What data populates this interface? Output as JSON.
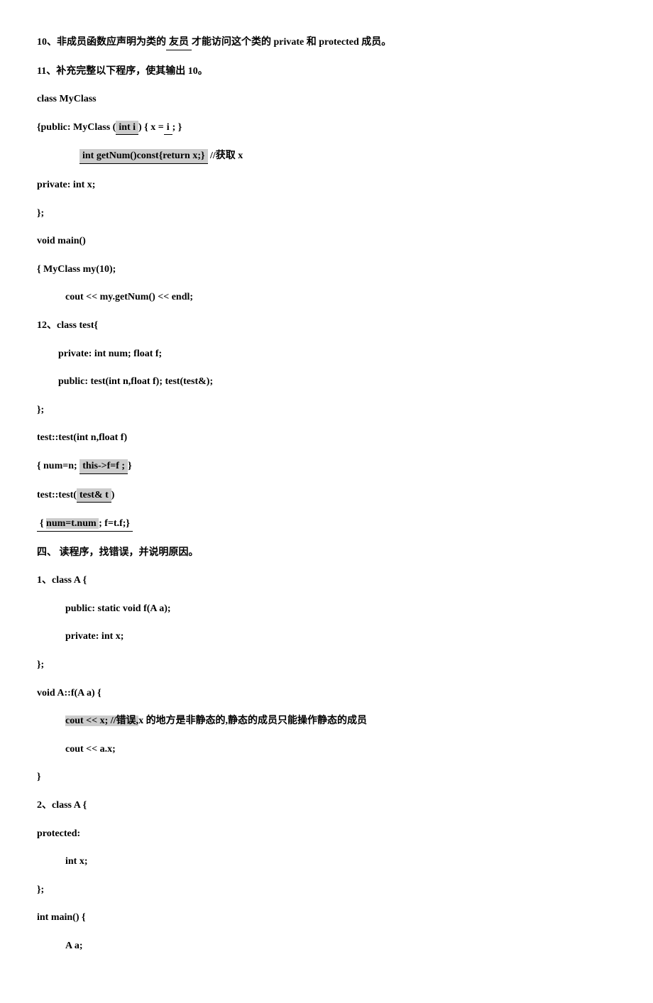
{
  "q10": {
    "prefix": "10、非成员函数应声明为类的",
    "blank1": "   友员         ",
    "suffix": "才能访问这个类的 private 和 protected 成员。"
  },
  "q11": {
    "title": "11、补充完整以下程序，使其输出    10。",
    "l1": "class MyClass",
    "l2a": "{public:      MyClass (",
    "l2b": "   int i   ",
    "l2c": ") { x =",
    "l2d": " i ",
    "l2e": "; }",
    "l3a": "  int getNum()const{return x;}    ",
    "l3b": " //获取 x",
    "l4": "private:      int x;",
    "l5": "};",
    "l6": "void main()",
    "l7": "{          MyClass my(10);",
    "l8": "cout << my.getNum() << endl;"
  },
  "q12": {
    "l1": "12、class test{",
    "l2": "private:     int num;           float f;",
    "l3": "public:    test(int n,float f);      test(test&);",
    "l4": "};",
    "l5": "test::test(int n,float f)",
    "l6a": "{     num=n;    ",
    "l6b": "    this->f=f ;",
    "l6c": "}",
    "l7a": "test::test(",
    "l7b": " test& t ",
    "l7c": ")",
    "l8a": "{    ",
    "l8b": "num=t.num     ",
    "l8c": ";         f=t.f;}"
  },
  "sec4": {
    "title": "四、 读程序，找错误，并说明原因。",
    "q1": {
      "l1": "1、class A {",
      "l2": "public:             static void f(A a);",
      "l3": "private:            int x;",
      "l4": "};",
      "l5": "void A::f(A a) {",
      "l6a": "cout << x;     //错误,",
      "l6b": "x 的地方是非静态的,静态的成员只能操作静态的成员",
      "l7": "cout << a.x;",
      "l8": "}"
    },
    "q2": {
      "l1": "2、class A {",
      "l2": "protected:",
      "l3": "int x;",
      "l4": "};",
      "l5": "int main() {",
      "l6": "A a;"
    }
  }
}
